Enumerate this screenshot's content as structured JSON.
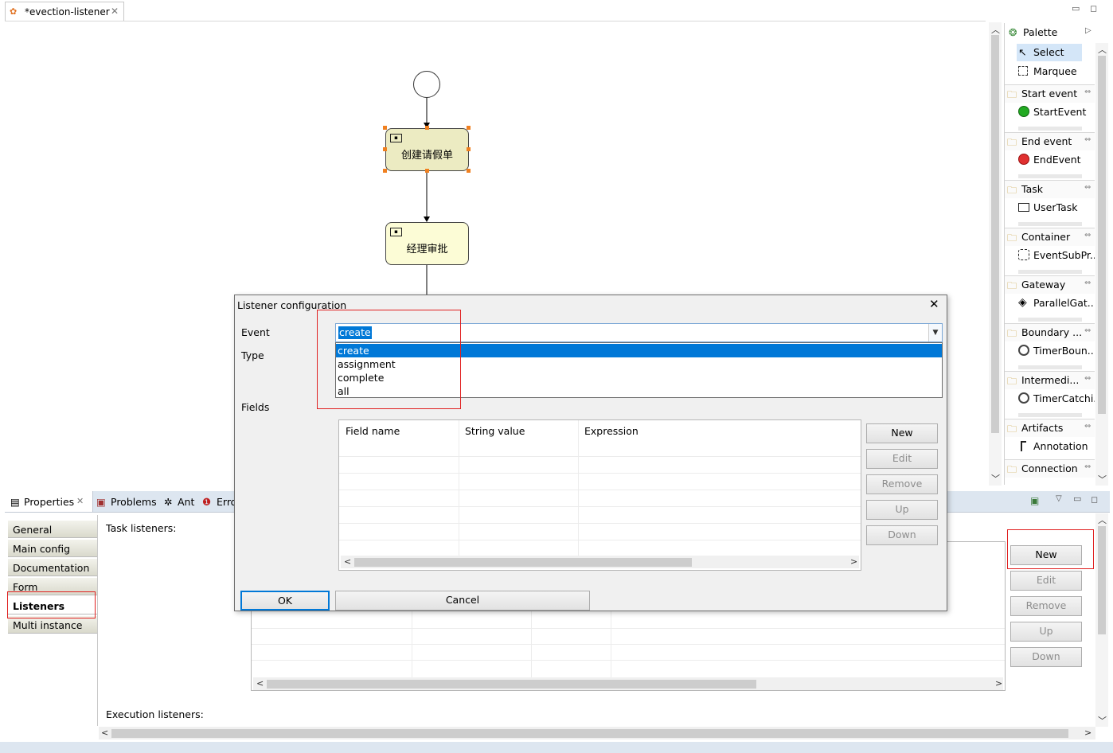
{
  "editor": {
    "tab_title": "*evection-listener",
    "nodes": {
      "task1": "创建请假单",
      "task2": "经理审批"
    }
  },
  "palette": {
    "title": "Palette",
    "tools": [
      {
        "label": "Select",
        "icon": "cursor-arrow-icon"
      },
      {
        "label": "Marquee",
        "icon": "marquee-icon"
      }
    ],
    "drawers": [
      {
        "label": "Start event",
        "item": "StartEvent",
        "icon": "start-event-icon"
      },
      {
        "label": "End event",
        "item": "EndEvent",
        "icon": "end-event-icon"
      },
      {
        "label": "Task",
        "item": "UserTask",
        "icon": "user-task-icon"
      },
      {
        "label": "Container",
        "item": "EventSubPr...",
        "icon": "subprocess-icon"
      },
      {
        "label": "Gateway",
        "item": "ParallelGat...",
        "icon": "parallel-gateway-icon"
      },
      {
        "label": "Boundary ...",
        "item": "TimerBoun...",
        "icon": "timer-icon"
      },
      {
        "label": "Intermedi...",
        "item": "TimerCatchi...",
        "icon": "timer-icon"
      },
      {
        "label": "Artifacts",
        "item": "Annotation",
        "icon": "annotation-icon"
      },
      {
        "label": "Connection",
        "item": "",
        "icon": "connection-icon"
      }
    ]
  },
  "panel": {
    "tabs": [
      {
        "label": "Properties",
        "icon": "properties-icon"
      },
      {
        "label": "Problems",
        "icon": "problems-icon"
      },
      {
        "label": "Ant",
        "icon": "ant-icon"
      },
      {
        "label": "Erro",
        "icon": "error-log-icon"
      }
    ],
    "side_tabs": [
      "General",
      "Main config",
      "Documentation",
      "Form",
      "Listeners",
      "Multi instance"
    ],
    "active_side_tab": "Listeners",
    "task_listeners_label": "Task listeners:",
    "execution_listeners_label": "Execution listeners:",
    "buttons": {
      "new": "New",
      "edit": "Edit",
      "remove": "Remove",
      "up": "Up",
      "down": "Down"
    }
  },
  "dialog": {
    "title": "Listener configuration",
    "event_label": "Event",
    "type_label": "Type",
    "fields_label": "Fields",
    "event_value": "create",
    "event_options": [
      "create",
      "assignment",
      "complete",
      "all"
    ],
    "columns": [
      "Field name",
      "String value",
      "Expression"
    ],
    "buttons": {
      "new": "New",
      "edit": "Edit",
      "remove": "Remove",
      "up": "Up",
      "down": "Down",
      "ok": "OK",
      "cancel": "Cancel"
    }
  }
}
